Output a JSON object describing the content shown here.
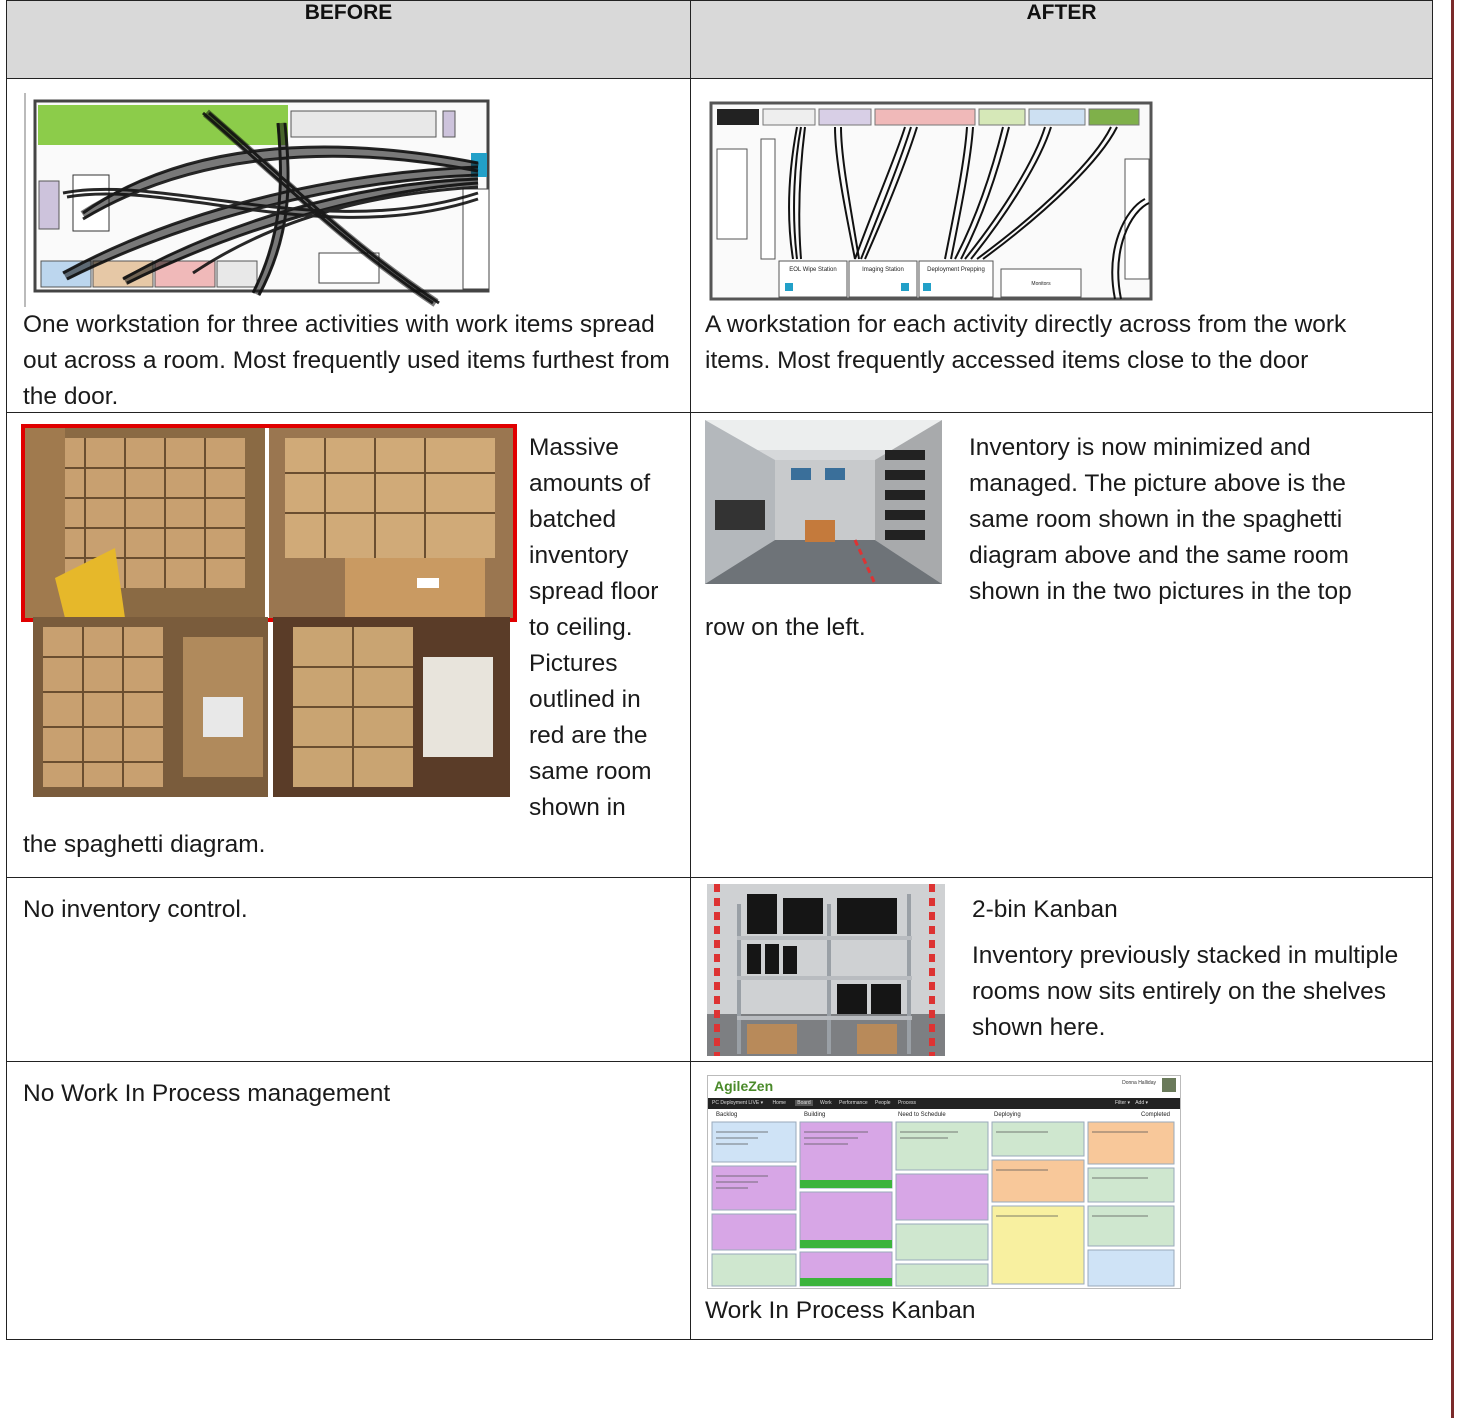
{
  "headers": {
    "before": "BEFORE",
    "after": "AFTER"
  },
  "rows": [
    {
      "before_text": "One workstation for three activities with work items spread out across a room.  Most frequently used items furthest from the door.",
      "after_text": "A workstation for each activity directly across from the work items.  Most frequently accessed items close to the door"
    },
    {
      "before_side_lines": [
        "Massive",
        "amounts of",
        "batched",
        "inventory",
        "spread floor",
        "to ceiling.",
        "Pictures",
        "outlined in",
        "red are the",
        "same room",
        "shown in"
      ],
      "before_tail": "the spaghetti diagram.",
      "after_lines": [
        "Inventory is now minimized and",
        "managed.  The picture above is the",
        "same room shown in the spaghetti",
        "diagram above and the same room",
        "shown in the two pictures in the top"
      ],
      "after_tail": "row on the left."
    },
    {
      "before_text": "No inventory control.",
      "after_title": "2-bin Kanban",
      "after_text": "Inventory previously stacked in multiple rooms now sits entirely on the shelves shown here."
    },
    {
      "before_text": "No Work In Process management",
      "after_caption": "Work In Process Kanban"
    }
  ],
  "after_floorplan_labels": {
    "stations": [
      "EOL Wipe Station",
      "Imaging Station",
      "Deployment Prepping"
    ],
    "shelf": "Monitors"
  },
  "agilezen": {
    "logo": "AgileZen",
    "user": "Donna Halliday",
    "nav": [
      "PC Deployment LIVE ▾",
      "Home",
      "Board",
      "Work",
      "Performance",
      "People",
      "Process"
    ],
    "right_nav": [
      "Filter ▾",
      "Add ▾"
    ],
    "columns": [
      "Backlog",
      "Building",
      "Need to Schedule",
      "Deploying",
      "Completed"
    ]
  },
  "colors": {
    "table_border": "#222222",
    "header_bg": "#d9d9d9",
    "red_outline": "#e00000",
    "floor_green": "#8ccc4a",
    "side_bar": "#7a2a2a"
  }
}
